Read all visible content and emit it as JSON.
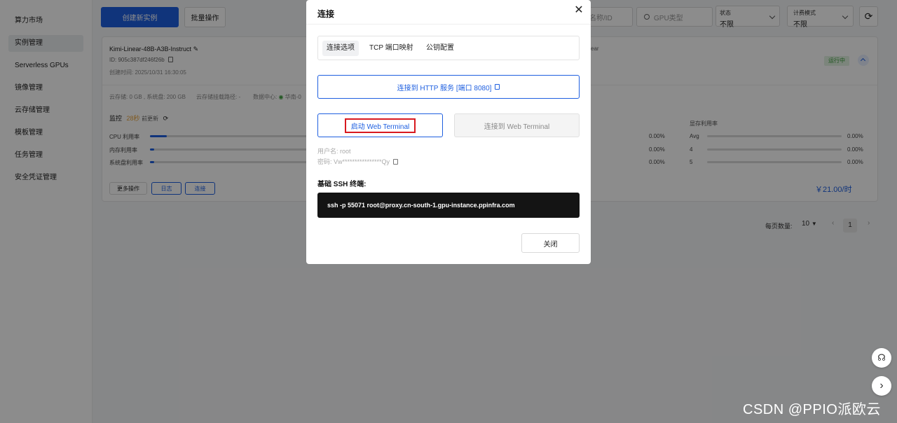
{
  "sidebar": {
    "items": [
      {
        "label": "算力市场"
      },
      {
        "label": "实例管理"
      },
      {
        "label": "Serverless GPUs"
      },
      {
        "label": "镜像管理"
      },
      {
        "label": "云存储管理"
      },
      {
        "label": "模板管理"
      },
      {
        "label": "任务管理"
      },
      {
        "label": "安全凭证管理"
      }
    ],
    "active_index": 1
  },
  "toolbar": {
    "create_label": "创建新实例",
    "batch_label": "批量操作",
    "search_placeholder": "名称/ID",
    "gpu_placeholder": "GPU类型",
    "status_label": "状态",
    "status_value": "不限",
    "billing_label": "计费模式",
    "billing_value": "不限"
  },
  "instance": {
    "name": "Kimi-Linear-48B-A3B-Instruct",
    "id": "ID: 905c387df246f26b",
    "created": "创建时间: 2025/10/31 16:30:05",
    "name_suffix": "ear",
    "status": "运行中",
    "storage_info": "云存储: 0 GB , 系统盘: 200 GB",
    "mount_path": "云存储挂载路径: -",
    "datacenter_label": "数据中心:",
    "datacenter_value": "华南-0",
    "monitor_label": "监控",
    "monitor_age": "28秒",
    "monitor_suffix": "前更新",
    "metrics": [
      {
        "label": "CPU 利用率",
        "value": "0.00%",
        "fill": 0.04
      },
      {
        "label": "内存利用率",
        "value": "0.00%",
        "fill": 0.01
      },
      {
        "label": "系统盘利用率",
        "value": "0.00%",
        "fill": 0.01
      }
    ],
    "vram_label": "显存利用率",
    "vram_rows": [
      {
        "label": "Avg",
        "value": "0.00%"
      },
      {
        "label": "4",
        "value": "0.00%"
      },
      {
        "label": "5",
        "value": "0.00%"
      }
    ],
    "more_label": "更多操作",
    "log_label": "日志",
    "connect_label": "连接",
    "price": "￥21.00/时"
  },
  "pagination": {
    "page_size_label": "每页数量:",
    "page_size": "10",
    "current_page": "1"
  },
  "modal": {
    "title": "连接",
    "tabs": [
      {
        "label": "连接选项"
      },
      {
        "label": "TCP 端口映射"
      },
      {
        "label": "公钥配置"
      }
    ],
    "http_button": "连接到 HTTP 服务 [端口 8080]",
    "start_terminal": "启动 Web Terminal",
    "connect_terminal": "连接到 Web Terminal",
    "username": "用户名: root",
    "password": "密码: Vw****************Qy",
    "ssh_label": "基础 SSH 终端:",
    "ssh_command": "ssh -p 55071 root@proxy.cn-south-1.gpu-instance.ppinfra.com",
    "close_label": "关闭"
  },
  "watermark": "CSDN @PPIO派欧云",
  "colors": {
    "accent": "#1e5fe0",
    "highlight": "#d8191f",
    "running": "#3a9b3a"
  }
}
